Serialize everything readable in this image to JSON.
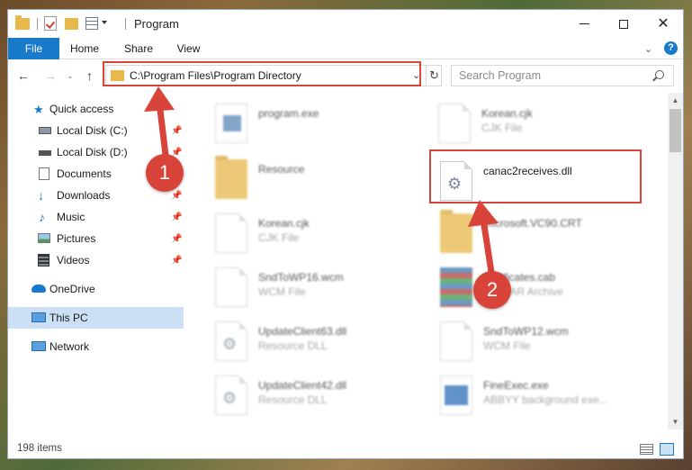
{
  "window": {
    "title": "Program"
  },
  "ribbon": {
    "tabs": [
      {
        "label": "File",
        "active": true
      },
      {
        "label": "Home"
      },
      {
        "label": "Share"
      },
      {
        "label": "View"
      }
    ]
  },
  "address_bar": {
    "path": "C:\\Program Files\\Program Directory"
  },
  "search": {
    "placeholder": "Search Program"
  },
  "sidebar": {
    "items": [
      {
        "label": "Quick access",
        "icon": "star-icon"
      },
      {
        "label": "Local Disk (C:)",
        "icon": "drive-icon",
        "pinned": true
      },
      {
        "label": "Local Disk (D:)",
        "icon": "drive-icon",
        "pinned": true
      },
      {
        "label": "Documents",
        "icon": "documents-icon",
        "pinned": true
      },
      {
        "label": "Downloads",
        "icon": "download-icon",
        "pinned": true
      },
      {
        "label": "Music",
        "icon": "music-icon",
        "pinned": true
      },
      {
        "label": "Pictures",
        "icon": "pictures-icon",
        "pinned": true
      },
      {
        "label": "Videos",
        "icon": "videos-icon",
        "pinned": true
      },
      {
        "label": "OneDrive",
        "icon": "cloud-icon"
      },
      {
        "label": "This PC",
        "icon": "computer-icon",
        "selected": true
      },
      {
        "label": "Network",
        "icon": "network-icon"
      }
    ]
  },
  "files": [
    {
      "name": "program.exe",
      "type": "",
      "icon": "exe-icon"
    },
    {
      "name": "Korean.cjk",
      "type": "CJK File",
      "icon": "document-icon"
    },
    {
      "name": "Resource",
      "type": "",
      "icon": "folder-icon"
    },
    {
      "name": "canac2receives.dll",
      "type": "",
      "icon": "dll-gear-icon",
      "highlighted": true
    },
    {
      "name": "Korean.cjk",
      "type": "CJK File",
      "icon": "document-icon"
    },
    {
      "name": "Microsoft.VC90.CRT",
      "type": "",
      "icon": "folder-icon"
    },
    {
      "name": "SndToWP16.wcm",
      "type": "WCM File",
      "icon": "document-icon"
    },
    {
      "name": "certificates.cab",
      "type": "WinRAR Archive",
      "icon": "archive-icon"
    },
    {
      "name": "UpdateClient63.dll",
      "type": "Resource DLL",
      "icon": "dll-gear-icon"
    },
    {
      "name": "SndToWP12.wcm",
      "type": "WCM File",
      "icon": "document-icon"
    },
    {
      "name": "UpdateClient42.dll",
      "type": "Resource DLL",
      "icon": "dll-gear-icon"
    },
    {
      "name": "FineExec.exe",
      "type": "ABBYY background exe...",
      "icon": "exe-icon"
    }
  ],
  "status": {
    "item_count": "198 items"
  },
  "annotations": {
    "step1": "1",
    "step2": "2",
    "color": "#d9443a"
  }
}
